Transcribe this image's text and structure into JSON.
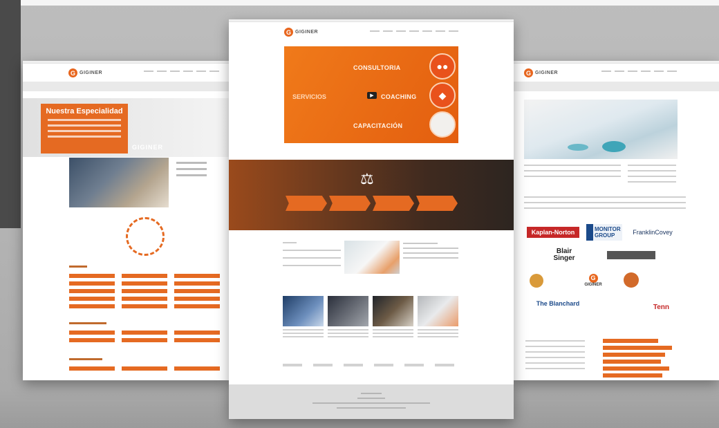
{
  "left": {
    "logo_mark": "G",
    "logo_text": "GIGINER",
    "hero_title": "Nuestra Especialidad",
    "hero_brand": "GIGINER"
  },
  "center": {
    "logo_mark": "G",
    "logo_text": "GIGINER",
    "banner": {
      "services": "SERVICIOS",
      "items": [
        "CONSULTORIA",
        "COACHING",
        "CAPACITACIÓN"
      ]
    }
  },
  "right": {
    "logo_mark": "G",
    "logo_text": "GIGINER",
    "partner_logos": {
      "kaplan": "Kaplan-Norton",
      "fcg": "MONITOR GROUP",
      "franklin": "FranklinCovey",
      "blair_1": "Blair",
      "blair_2": "Singer",
      "giginer": "GIGINER",
      "blanchard": "The Blanchard",
      "tenn": "Tenn"
    }
  },
  "colors": {
    "accent": "#e56a22",
    "dark_band": "#3f2a1f",
    "background": "#b8b8b8"
  }
}
